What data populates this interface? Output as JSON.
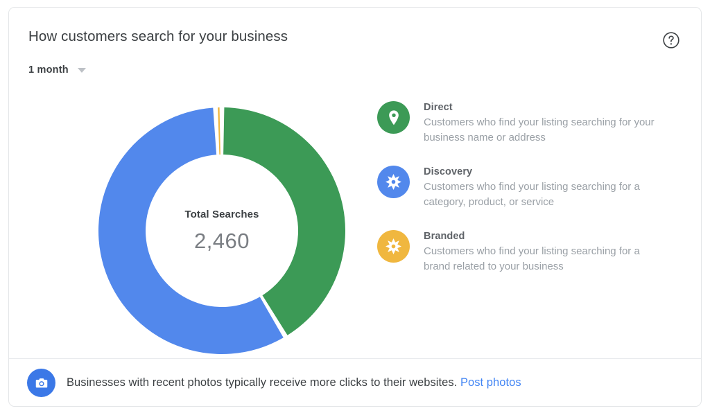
{
  "header": {
    "title": "How customers search for your business",
    "range_label": "1 month",
    "help_icon": "help-circle-icon",
    "caret_icon": "chevron-down-icon"
  },
  "donut": {
    "center_label": "Total Searches",
    "center_value": "2,460"
  },
  "legend": {
    "items": [
      {
        "name": "Direct",
        "description": "Customers who find your listing searching for your business name or address",
        "color": "#3c9a56",
        "icon": "map-pin-icon"
      },
      {
        "name": "Discovery",
        "description": "Customers who find your listing searching for a category, product, or service",
        "color": "#5288ec",
        "icon": "compass-star-icon"
      },
      {
        "name": "Branded",
        "description": "Customers who find your listing searching for a brand related to your business",
        "color": "#f0b73f",
        "icon": "compass-star-icon"
      }
    ]
  },
  "footer": {
    "icon": "camera-icon",
    "message": "Businesses with recent photos typically receive more clicks to their websites.",
    "link_label": "Post photos"
  },
  "chart_data": {
    "type": "pie",
    "variant": "donut",
    "title": "How customers search for your business",
    "total_label": "Total Searches",
    "total": 2460,
    "period": "1 month",
    "categories": [
      "Direct",
      "Discovery",
      "Branded"
    ],
    "values": [
      1019,
      1421,
      20
    ],
    "percentages": [
      41.4,
      57.8,
      0.8
    ],
    "angles_deg": [
      149,
      208,
      3
    ],
    "colors": [
      "#3c9a56",
      "#5288ec",
      "#f0b73f"
    ],
    "start_angle_deg": 0,
    "direction": "clockwise",
    "inner_radius": 110,
    "outer_radius": 178,
    "legend_position": "right",
    "grid": false
  }
}
